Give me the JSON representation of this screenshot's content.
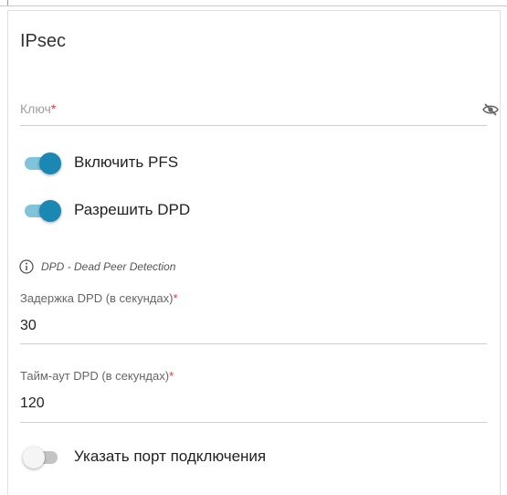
{
  "section": {
    "title": "IPsec"
  },
  "key": {
    "label": "Ключ",
    "required_mark": "*"
  },
  "pfs": {
    "label": "Включить PFS",
    "enabled": true
  },
  "dpd": {
    "label": "Разрешить DPD",
    "enabled": true,
    "info": "DPD - Dead Peer Detection"
  },
  "dpd_delay": {
    "label": "Задержка DPD (в секундах)",
    "required_mark": "*",
    "value": "30"
  },
  "dpd_timeout": {
    "label": "Тайм-аут DPD (в секундах)",
    "required_mark": "*",
    "value": "120"
  },
  "connection_port": {
    "label": "Указать порт подключения",
    "enabled": false
  },
  "colors": {
    "toggle_on_knob": "#1b87b3",
    "toggle_on_track": "#7fc4da",
    "required": "#e53935"
  }
}
